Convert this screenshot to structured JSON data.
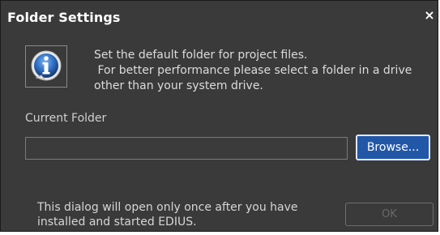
{
  "dialog": {
    "title": "Folder Settings",
    "close_label": "×",
    "info_icon": "info-icon",
    "message": "Set the default folder for project files.\n For better performance please select a folder in a drive\nother than your system drive.",
    "current_folder_label": "Current Folder",
    "current_folder_value": "",
    "browse_label": "Browse...",
    "footer_note": "This dialog will open only once after you have\ninstalled and started EDIUS.",
    "ok_label": "OK",
    "ok_enabled": false
  },
  "colors": {
    "background": "#3a3a3a",
    "accent": "#2257a8",
    "text": "#d9d9d9"
  }
}
